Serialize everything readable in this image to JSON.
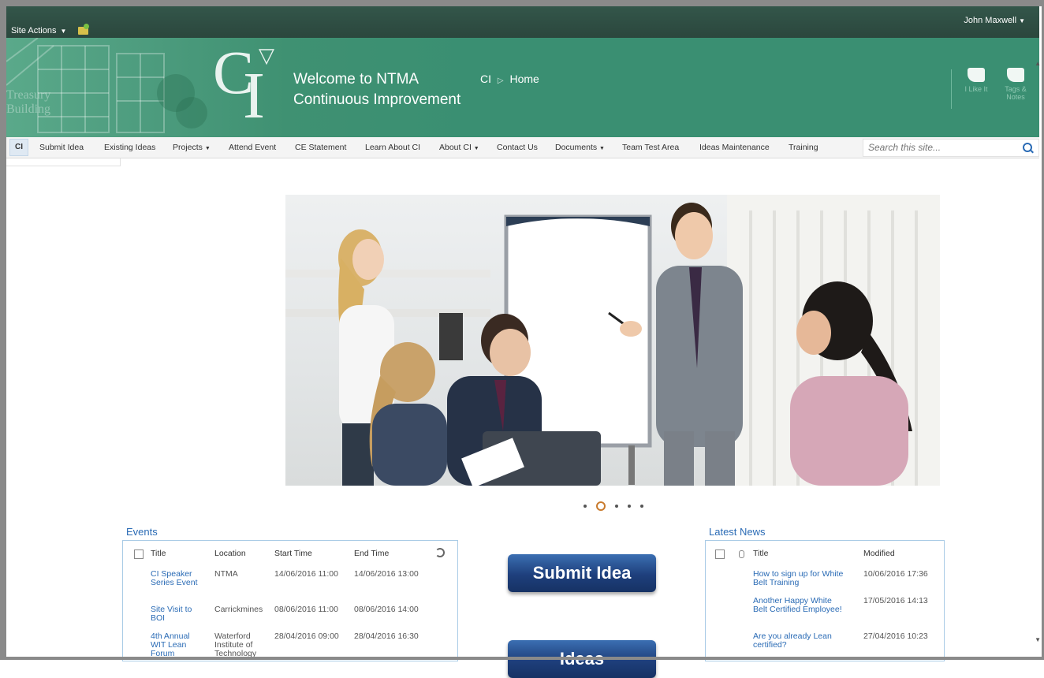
{
  "topbar": {
    "site_actions": "Site Actions",
    "user": "John Maxwell"
  },
  "banner": {
    "treasury_text_1": "Treasury",
    "treasury_text_2": "Building",
    "logo_c": "C",
    "logo_i": "I",
    "welcome_line1": "Welcome to NTMA",
    "welcome_line2": "Continuous Improvement",
    "breadcrumb_root": "CI",
    "breadcrumb_current": "Home",
    "tag_label": "I Like It",
    "tag_icon": "tag-icon",
    "note_label": "Tags & Notes",
    "note_icon": "note-icon"
  },
  "nav": {
    "items": [
      {
        "label": "CI"
      },
      {
        "label": "Submit Idea"
      },
      {
        "label": "Existing Ideas"
      },
      {
        "label": "Projects",
        "dropdown": true
      },
      {
        "label": "Attend Event"
      },
      {
        "label": "CE Statement"
      },
      {
        "label": "Learn About CI"
      },
      {
        "label": "About CI",
        "dropdown": true
      },
      {
        "label": "Contact Us"
      },
      {
        "label": "Documents",
        "dropdown": true
      },
      {
        "label": "Team Test Area"
      },
      {
        "label": "Ideas Maintenance"
      },
      {
        "label": "Training"
      }
    ],
    "search_placeholder": "Search this site..."
  },
  "carousel": {
    "slide_count": 5,
    "active_index": 1
  },
  "events": {
    "title": "Events",
    "columns": [
      "Title",
      "Location",
      "Start Time",
      "End Time"
    ],
    "rows": [
      {
        "title": "CI Speaker Series Event",
        "location": "NTMA",
        "start": "14/06/2016 11:00",
        "end": "14/06/2016 13:00"
      },
      {
        "title": "Site Visit to BOI",
        "location": "Carrickmines",
        "start": "08/06/2016 11:00",
        "end": "08/06/2016 14:00"
      },
      {
        "title": "4th Annual WIT Lean Forum",
        "location": "Waterford Institute of Technology",
        "start": "28/04/2016 09:00",
        "end": "28/04/2016 16:30"
      }
    ]
  },
  "buttons": {
    "submit_idea": "Submit Idea",
    "ideas": "Ideas"
  },
  "news": {
    "title": "Latest News",
    "columns": [
      "Title",
      "Modified"
    ],
    "rows": [
      {
        "title": "How to sign up for White Belt Training",
        "modified": "10/06/2016 17:36"
      },
      {
        "title": "Another Happy White Belt Certified Employee!",
        "modified": "17/05/2016 14:13"
      },
      {
        "title": "Are you already Lean certified?",
        "modified": "27/04/2016 10:23"
      }
    ]
  },
  "colors": {
    "banner": "#3a8f72",
    "topbar": "#2f4f44",
    "link": "#2a6bb5",
    "button": "#1e3f7c"
  }
}
